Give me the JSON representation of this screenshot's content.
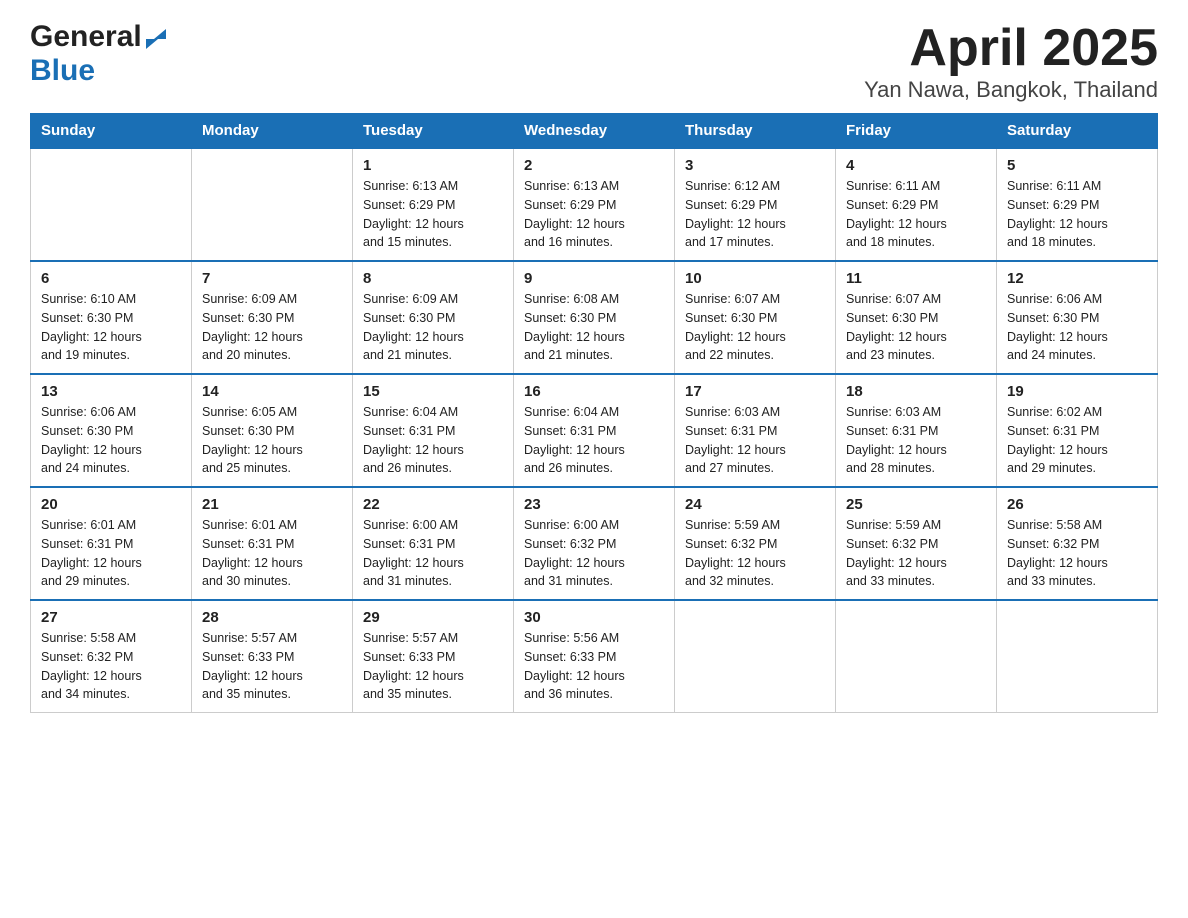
{
  "header": {
    "logo_general": "General",
    "logo_blue": "Blue",
    "title": "April 2025",
    "subtitle": "Yan Nawa, Bangkok, Thailand"
  },
  "calendar": {
    "days_of_week": [
      "Sunday",
      "Monday",
      "Tuesday",
      "Wednesday",
      "Thursday",
      "Friday",
      "Saturday"
    ],
    "weeks": [
      [
        {
          "day": "",
          "info": ""
        },
        {
          "day": "",
          "info": ""
        },
        {
          "day": "1",
          "info": "Sunrise: 6:13 AM\nSunset: 6:29 PM\nDaylight: 12 hours\nand 15 minutes."
        },
        {
          "day": "2",
          "info": "Sunrise: 6:13 AM\nSunset: 6:29 PM\nDaylight: 12 hours\nand 16 minutes."
        },
        {
          "day": "3",
          "info": "Sunrise: 6:12 AM\nSunset: 6:29 PM\nDaylight: 12 hours\nand 17 minutes."
        },
        {
          "day": "4",
          "info": "Sunrise: 6:11 AM\nSunset: 6:29 PM\nDaylight: 12 hours\nand 18 minutes."
        },
        {
          "day": "5",
          "info": "Sunrise: 6:11 AM\nSunset: 6:29 PM\nDaylight: 12 hours\nand 18 minutes."
        }
      ],
      [
        {
          "day": "6",
          "info": "Sunrise: 6:10 AM\nSunset: 6:30 PM\nDaylight: 12 hours\nand 19 minutes."
        },
        {
          "day": "7",
          "info": "Sunrise: 6:09 AM\nSunset: 6:30 PM\nDaylight: 12 hours\nand 20 minutes."
        },
        {
          "day": "8",
          "info": "Sunrise: 6:09 AM\nSunset: 6:30 PM\nDaylight: 12 hours\nand 21 minutes."
        },
        {
          "day": "9",
          "info": "Sunrise: 6:08 AM\nSunset: 6:30 PM\nDaylight: 12 hours\nand 21 minutes."
        },
        {
          "day": "10",
          "info": "Sunrise: 6:07 AM\nSunset: 6:30 PM\nDaylight: 12 hours\nand 22 minutes."
        },
        {
          "day": "11",
          "info": "Sunrise: 6:07 AM\nSunset: 6:30 PM\nDaylight: 12 hours\nand 23 minutes."
        },
        {
          "day": "12",
          "info": "Sunrise: 6:06 AM\nSunset: 6:30 PM\nDaylight: 12 hours\nand 24 minutes."
        }
      ],
      [
        {
          "day": "13",
          "info": "Sunrise: 6:06 AM\nSunset: 6:30 PM\nDaylight: 12 hours\nand 24 minutes."
        },
        {
          "day": "14",
          "info": "Sunrise: 6:05 AM\nSunset: 6:30 PM\nDaylight: 12 hours\nand 25 minutes."
        },
        {
          "day": "15",
          "info": "Sunrise: 6:04 AM\nSunset: 6:31 PM\nDaylight: 12 hours\nand 26 minutes."
        },
        {
          "day": "16",
          "info": "Sunrise: 6:04 AM\nSunset: 6:31 PM\nDaylight: 12 hours\nand 26 minutes."
        },
        {
          "day": "17",
          "info": "Sunrise: 6:03 AM\nSunset: 6:31 PM\nDaylight: 12 hours\nand 27 minutes."
        },
        {
          "day": "18",
          "info": "Sunrise: 6:03 AM\nSunset: 6:31 PM\nDaylight: 12 hours\nand 28 minutes."
        },
        {
          "day": "19",
          "info": "Sunrise: 6:02 AM\nSunset: 6:31 PM\nDaylight: 12 hours\nand 29 minutes."
        }
      ],
      [
        {
          "day": "20",
          "info": "Sunrise: 6:01 AM\nSunset: 6:31 PM\nDaylight: 12 hours\nand 29 minutes."
        },
        {
          "day": "21",
          "info": "Sunrise: 6:01 AM\nSunset: 6:31 PM\nDaylight: 12 hours\nand 30 minutes."
        },
        {
          "day": "22",
          "info": "Sunrise: 6:00 AM\nSunset: 6:31 PM\nDaylight: 12 hours\nand 31 minutes."
        },
        {
          "day": "23",
          "info": "Sunrise: 6:00 AM\nSunset: 6:32 PM\nDaylight: 12 hours\nand 31 minutes."
        },
        {
          "day": "24",
          "info": "Sunrise: 5:59 AM\nSunset: 6:32 PM\nDaylight: 12 hours\nand 32 minutes."
        },
        {
          "day": "25",
          "info": "Sunrise: 5:59 AM\nSunset: 6:32 PM\nDaylight: 12 hours\nand 33 minutes."
        },
        {
          "day": "26",
          "info": "Sunrise: 5:58 AM\nSunset: 6:32 PM\nDaylight: 12 hours\nand 33 minutes."
        }
      ],
      [
        {
          "day": "27",
          "info": "Sunrise: 5:58 AM\nSunset: 6:32 PM\nDaylight: 12 hours\nand 34 minutes."
        },
        {
          "day": "28",
          "info": "Sunrise: 5:57 AM\nSunset: 6:33 PM\nDaylight: 12 hours\nand 35 minutes."
        },
        {
          "day": "29",
          "info": "Sunrise: 5:57 AM\nSunset: 6:33 PM\nDaylight: 12 hours\nand 35 minutes."
        },
        {
          "day": "30",
          "info": "Sunrise: 5:56 AM\nSunset: 6:33 PM\nDaylight: 12 hours\nand 36 minutes."
        },
        {
          "day": "",
          "info": ""
        },
        {
          "day": "",
          "info": ""
        },
        {
          "day": "",
          "info": ""
        }
      ]
    ]
  }
}
